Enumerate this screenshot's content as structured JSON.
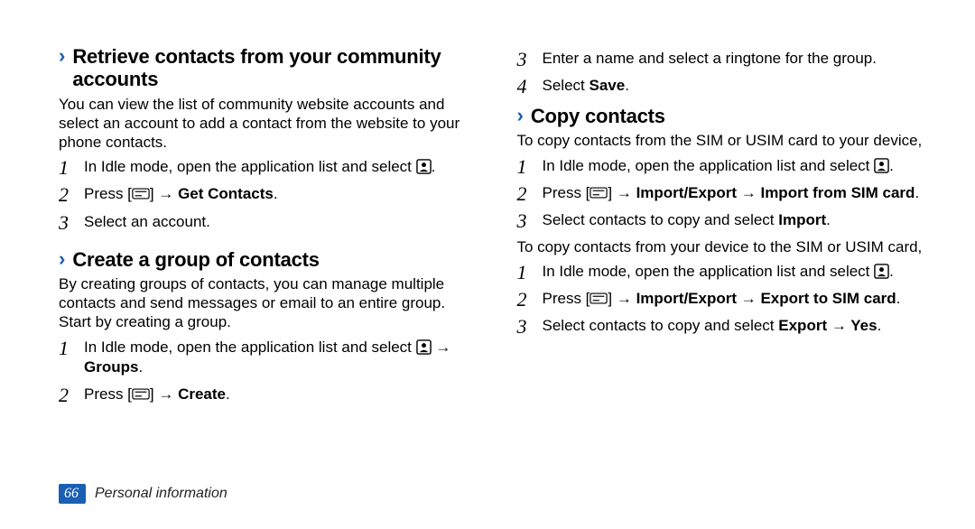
{
  "left": {
    "s1": {
      "title": "Retrieve contacts from your community accounts",
      "intro": "You can view the list of community website accounts and select an account to add a contact from the website to your phone contacts.",
      "step1a": "In Idle mode, open the application list and select ",
      "step1b": ".",
      "step2a": "Press [",
      "step2b": "] → ",
      "step2bold": "Get Contacts",
      "step2c": ".",
      "step3": "Select an account."
    },
    "s2": {
      "title": "Create a group of contacts",
      "intro": "By creating groups of contacts, you can manage multiple contacts and send messages or email to an entire group. Start by creating a group.",
      "step1a": "In Idle mode, open the application list and select ",
      "step1arrow": " → ",
      "step1bold": "Groups",
      "step1c": ".",
      "step2a": "Press [",
      "step2b": "] → ",
      "step2bold": "Create",
      "step2c": "."
    }
  },
  "right": {
    "cont": {
      "step3": "Enter a name and select a ringtone for the group.",
      "step4a": "Select ",
      "step4bold": "Save",
      "step4b": "."
    },
    "s3": {
      "title": "Copy contacts",
      "intro1": "To copy contacts from the SIM or USIM card to your device,",
      "a_step1a": "In Idle mode, open the application list and select ",
      "a_step1b": ".",
      "a_step2a": "Press [",
      "a_step2b": "] → ",
      "a_step2bold": "Import/Export → Import from SIM card",
      "a_step2c": ".",
      "a_step3a": "Select contacts to copy and select ",
      "a_step3bold": "Import",
      "a_step3b": ".",
      "intro2": "To copy contacts from your device to the SIM or USIM card,",
      "b_step1a": "In Idle mode, open the application list and select ",
      "b_step1b": ".",
      "b_step2a": "Press [",
      "b_step2b": "] → ",
      "b_step2bold": "Import/Export → Export to SIM card",
      "b_step2c": ".",
      "b_step3a": "Select contacts to copy and select ",
      "b_step3bold": "Export → Yes",
      "b_step3b": "."
    }
  },
  "footer": {
    "page": "66",
    "label": "Personal information"
  }
}
